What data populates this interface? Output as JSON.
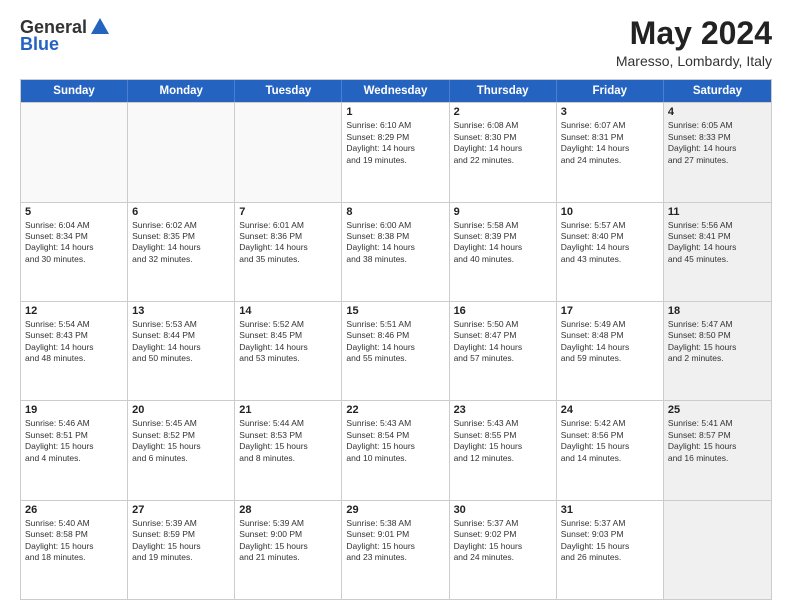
{
  "header": {
    "logo_line1": "General",
    "logo_line2": "Blue",
    "month_year": "May 2024",
    "location": "Maresso, Lombardy, Italy"
  },
  "days_of_week": [
    "Sunday",
    "Monday",
    "Tuesday",
    "Wednesday",
    "Thursday",
    "Friday",
    "Saturday"
  ],
  "weeks": [
    [
      {
        "day": "",
        "info": "",
        "empty": true
      },
      {
        "day": "",
        "info": "",
        "empty": true
      },
      {
        "day": "",
        "info": "",
        "empty": true
      },
      {
        "day": "1",
        "info": "Sunrise: 6:10 AM\nSunset: 8:29 PM\nDaylight: 14 hours\nand 19 minutes.",
        "empty": false
      },
      {
        "day": "2",
        "info": "Sunrise: 6:08 AM\nSunset: 8:30 PM\nDaylight: 14 hours\nand 22 minutes.",
        "empty": false
      },
      {
        "day": "3",
        "info": "Sunrise: 6:07 AM\nSunset: 8:31 PM\nDaylight: 14 hours\nand 24 minutes.",
        "empty": false
      },
      {
        "day": "4",
        "info": "Sunrise: 6:05 AM\nSunset: 8:33 PM\nDaylight: 14 hours\nand 27 minutes.",
        "empty": false,
        "shaded": true
      }
    ],
    [
      {
        "day": "5",
        "info": "Sunrise: 6:04 AM\nSunset: 8:34 PM\nDaylight: 14 hours\nand 30 minutes.",
        "empty": false
      },
      {
        "day": "6",
        "info": "Sunrise: 6:02 AM\nSunset: 8:35 PM\nDaylight: 14 hours\nand 32 minutes.",
        "empty": false
      },
      {
        "day": "7",
        "info": "Sunrise: 6:01 AM\nSunset: 8:36 PM\nDaylight: 14 hours\nand 35 minutes.",
        "empty": false
      },
      {
        "day": "8",
        "info": "Sunrise: 6:00 AM\nSunset: 8:38 PM\nDaylight: 14 hours\nand 38 minutes.",
        "empty": false
      },
      {
        "day": "9",
        "info": "Sunrise: 5:58 AM\nSunset: 8:39 PM\nDaylight: 14 hours\nand 40 minutes.",
        "empty": false
      },
      {
        "day": "10",
        "info": "Sunrise: 5:57 AM\nSunset: 8:40 PM\nDaylight: 14 hours\nand 43 minutes.",
        "empty": false
      },
      {
        "day": "11",
        "info": "Sunrise: 5:56 AM\nSunset: 8:41 PM\nDaylight: 14 hours\nand 45 minutes.",
        "empty": false,
        "shaded": true
      }
    ],
    [
      {
        "day": "12",
        "info": "Sunrise: 5:54 AM\nSunset: 8:43 PM\nDaylight: 14 hours\nand 48 minutes.",
        "empty": false
      },
      {
        "day": "13",
        "info": "Sunrise: 5:53 AM\nSunset: 8:44 PM\nDaylight: 14 hours\nand 50 minutes.",
        "empty": false
      },
      {
        "day": "14",
        "info": "Sunrise: 5:52 AM\nSunset: 8:45 PM\nDaylight: 14 hours\nand 53 minutes.",
        "empty": false
      },
      {
        "day": "15",
        "info": "Sunrise: 5:51 AM\nSunset: 8:46 PM\nDaylight: 14 hours\nand 55 minutes.",
        "empty": false
      },
      {
        "day": "16",
        "info": "Sunrise: 5:50 AM\nSunset: 8:47 PM\nDaylight: 14 hours\nand 57 minutes.",
        "empty": false
      },
      {
        "day": "17",
        "info": "Sunrise: 5:49 AM\nSunset: 8:48 PM\nDaylight: 14 hours\nand 59 minutes.",
        "empty": false
      },
      {
        "day": "18",
        "info": "Sunrise: 5:47 AM\nSunset: 8:50 PM\nDaylight: 15 hours\nand 2 minutes.",
        "empty": false,
        "shaded": true
      }
    ],
    [
      {
        "day": "19",
        "info": "Sunrise: 5:46 AM\nSunset: 8:51 PM\nDaylight: 15 hours\nand 4 minutes.",
        "empty": false
      },
      {
        "day": "20",
        "info": "Sunrise: 5:45 AM\nSunset: 8:52 PM\nDaylight: 15 hours\nand 6 minutes.",
        "empty": false
      },
      {
        "day": "21",
        "info": "Sunrise: 5:44 AM\nSunset: 8:53 PM\nDaylight: 15 hours\nand 8 minutes.",
        "empty": false
      },
      {
        "day": "22",
        "info": "Sunrise: 5:43 AM\nSunset: 8:54 PM\nDaylight: 15 hours\nand 10 minutes.",
        "empty": false
      },
      {
        "day": "23",
        "info": "Sunrise: 5:43 AM\nSunset: 8:55 PM\nDaylight: 15 hours\nand 12 minutes.",
        "empty": false
      },
      {
        "day": "24",
        "info": "Sunrise: 5:42 AM\nSunset: 8:56 PM\nDaylight: 15 hours\nand 14 minutes.",
        "empty": false
      },
      {
        "day": "25",
        "info": "Sunrise: 5:41 AM\nSunset: 8:57 PM\nDaylight: 15 hours\nand 16 minutes.",
        "empty": false,
        "shaded": true
      }
    ],
    [
      {
        "day": "26",
        "info": "Sunrise: 5:40 AM\nSunset: 8:58 PM\nDaylight: 15 hours\nand 18 minutes.",
        "empty": false
      },
      {
        "day": "27",
        "info": "Sunrise: 5:39 AM\nSunset: 8:59 PM\nDaylight: 15 hours\nand 19 minutes.",
        "empty": false
      },
      {
        "day": "28",
        "info": "Sunrise: 5:39 AM\nSunset: 9:00 PM\nDaylight: 15 hours\nand 21 minutes.",
        "empty": false
      },
      {
        "day": "29",
        "info": "Sunrise: 5:38 AM\nSunset: 9:01 PM\nDaylight: 15 hours\nand 23 minutes.",
        "empty": false
      },
      {
        "day": "30",
        "info": "Sunrise: 5:37 AM\nSunset: 9:02 PM\nDaylight: 15 hours\nand 24 minutes.",
        "empty": false
      },
      {
        "day": "31",
        "info": "Sunrise: 5:37 AM\nSunset: 9:03 PM\nDaylight: 15 hours\nand 26 minutes.",
        "empty": false
      },
      {
        "day": "",
        "info": "",
        "empty": true,
        "shaded": true
      }
    ]
  ]
}
